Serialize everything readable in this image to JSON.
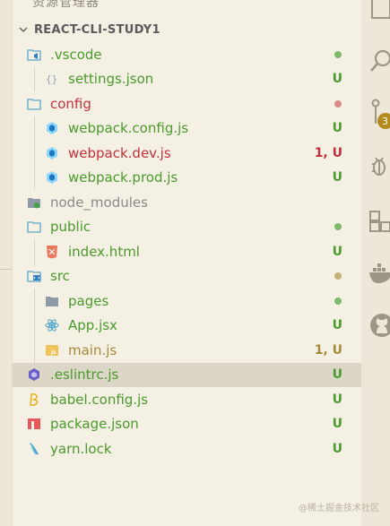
{
  "explorer": {
    "title": "资源管理器",
    "project_name": "REACT-CLI-STUDY1"
  },
  "colors": {
    "green": "#4a9a2c",
    "red": "#c2303a",
    "dim": "#8a8a8a",
    "text": "#3b3b3b",
    "ochre": "#a68a3a",
    "dot_green": "#7db86b",
    "dot_red": "#d98b8b",
    "dot_ochre": "#c8b07a"
  },
  "tree": [
    {
      "label": ".vscode",
      "icon": "vscode-folder-icon",
      "depth": 0,
      "color": "green",
      "dot": "dot_green"
    },
    {
      "label": "settings.json",
      "icon": "json-braces-icon",
      "depth": 1,
      "color": "green",
      "status": "U"
    },
    {
      "label": "config",
      "icon": "folder-icon",
      "depth": 0,
      "color": "red",
      "dot": "dot_red"
    },
    {
      "label": "webpack.config.js",
      "icon": "webpack-icon",
      "depth": 1,
      "color": "green",
      "status": "U"
    },
    {
      "label": "webpack.dev.js",
      "icon": "webpack-icon",
      "depth": 1,
      "color": "red",
      "status": "1, U"
    },
    {
      "label": "webpack.prod.js",
      "icon": "webpack-icon",
      "depth": 1,
      "color": "green",
      "status": "U"
    },
    {
      "label": "node_modules",
      "icon": "node-folder-icon",
      "depth": 0,
      "color": "dim"
    },
    {
      "label": "public",
      "icon": "folder-icon",
      "depth": 0,
      "color": "green",
      "dot": "dot_green"
    },
    {
      "label": "index.html",
      "icon": "html-icon",
      "depth": 1,
      "color": "green",
      "status": "U"
    },
    {
      "label": "src",
      "icon": "src-folder-icon",
      "depth": 0,
      "color": "green",
      "dot": "dot_ochre"
    },
    {
      "label": "pages",
      "icon": "folder-closed-icon",
      "depth": 1,
      "color": "green",
      "dot": "dot_green"
    },
    {
      "label": "App.jsx",
      "icon": "react-icon",
      "depth": 1,
      "color": "green",
      "status": "U"
    },
    {
      "label": "main.js",
      "icon": "js-icon",
      "depth": 1,
      "color": "ochre",
      "status": "1, U"
    },
    {
      "label": ".eslintrc.js",
      "icon": "eslint-icon",
      "depth": 0,
      "color": "green",
      "status": "U",
      "selected": true
    },
    {
      "label": "babel.config.js",
      "icon": "babel-icon",
      "depth": 0,
      "color": "green",
      "status": "U"
    },
    {
      "label": "package.json",
      "icon": "npm-icon",
      "depth": 0,
      "color": "green",
      "status": "U"
    },
    {
      "label": "yarn.lock",
      "icon": "yarn-icon",
      "depth": 0,
      "color": "green",
      "status": "U"
    }
  ],
  "activity_bar": {
    "scm_badge": "3",
    "icons": [
      "files-icon",
      "search-icon",
      "source-control-icon",
      "run-debug-icon",
      "extensions-icon",
      "docker-icon",
      "github-icon"
    ]
  },
  "watermark": "@稀土掘金技术社区"
}
